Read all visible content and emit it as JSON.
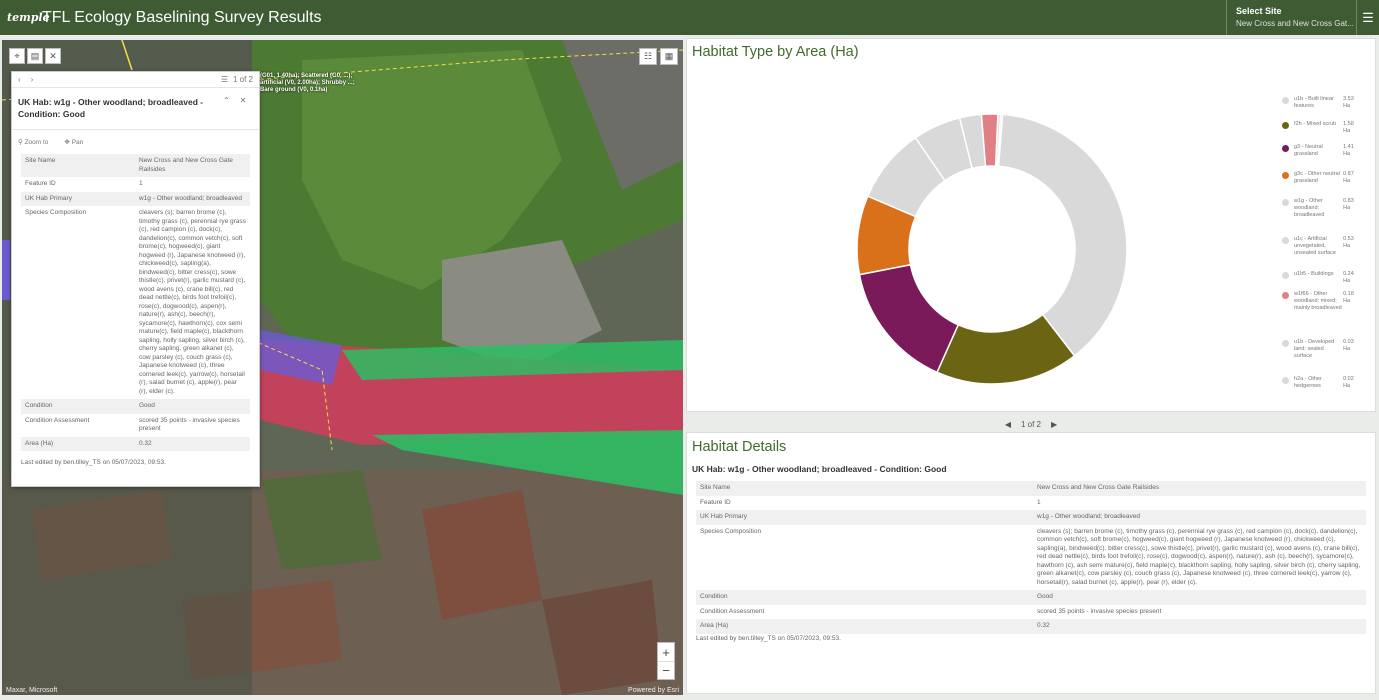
{
  "header": {
    "logo": "temple",
    "title": "TFL Ecology Baselining Survey Results",
    "select_site_label": "Select Site",
    "select_site_value": "New Cross and New Cross Gat...",
    "menu_icon": "hamburger-icon"
  },
  "map": {
    "feature_label": "(G01, 1.40ha); Scattered (G0, ...); artificial (V0, 2.00ha); Shrubby ...; Bare ground (V0, 0.1ha)",
    "attribution_left": "Maxar, Microsoft",
    "attribution_right": "Powered by Esri",
    "zoom_in": "+",
    "zoom_out": "−"
  },
  "popup": {
    "pager": "1 of 2",
    "title": "UK Hab: w1g - Other woodland; broadleaved - Condition: Good",
    "zoom_to": "Zoom to",
    "pan": "Pan",
    "rows": [
      {
        "k": "Site Name",
        "v": "New Cross and New Cross Gate Railsides"
      },
      {
        "k": "Feature ID",
        "v": "1"
      },
      {
        "k": "UK Hab Primary",
        "v": "w1g - Other woodland; broadleaved"
      },
      {
        "k": "Species Composition",
        "v": "cleavers (s); barren brome (c), timothy grass (c), perennial rye grass (c), red campion (c), dock(c), dandelion(c), common vetch(c), soft brome(c), hogweed(c), giant hogweed (r), Japanese knotweed (r), chickweed(c), sapling(a), bindweed(c), bitter cress(c), sowe thistle(c), privet(r), garlic mustard (c), wood avens (c), crane bill(c), red dead nettle(c), birds foot trefoil(c), rose(c), dogwood(c), aspen(r), nature(r), ash(c), beech(r), sycamore(c), hawthorn(c), cox semi mature(c), field maple(c), blackthorn sapling, holly sapling, silver birch (c), cherry sapling, green alkanet (c), cow parsley (c), couch grass (c), Japanese knotweed (c), three cornered leek(c), yarrow(c), horsetail (r), salad burnet (c), apple(r), pear (r), elder (c)."
      },
      {
        "k": "Condition",
        "v": "Good"
      },
      {
        "k": "Condition Assessment",
        "v": "scored 35 points - invasive species present"
      },
      {
        "k": "Area (Ha)",
        "v": "0.32"
      }
    ],
    "last_edited": "Last edited by ben.tilley_TS on 05/07/2023, 09:53."
  },
  "chart": {
    "title": "Habitat Type by Area (Ha)"
  },
  "chart_data": {
    "type": "pie",
    "title": "Habitat Type by Area (Ha)",
    "donut": true,
    "legend_position": "right",
    "series": [
      {
        "name": "u1b - Built linear features",
        "value": 3.53,
        "color": "#d9d9d9"
      },
      {
        "name": "f2h - Mixed scrub",
        "value": 1.58,
        "color": "#6b6412"
      },
      {
        "name": "g3 - Neutral grassland",
        "value": 1.41,
        "color": "#7b1a5a"
      },
      {
        "name": "g3c - Other neutral grassland",
        "value": 0.87,
        "color": "#d9701a"
      },
      {
        "name": "w1g - Other woodland; broadleaved",
        "value": 0.83,
        "color": "#d9d9d9"
      },
      {
        "name": "u1c - Artificial unvegetated, unsealed surface",
        "value": 0.53,
        "color": "#d9d9d9"
      },
      {
        "name": "u1b5 - Buildings",
        "value": 0.24,
        "color": "#d9d9d9"
      },
      {
        "name": "w1f66 - Other woodland; mixed; mainly broadleaved",
        "value": 0.18,
        "color": "#e07f86"
      },
      {
        "name": "u1b - Developed land; sealed surface",
        "value": 0.03,
        "color": "#d9d9d9"
      },
      {
        "name": "h2a - Other hedgerows",
        "value": 0.02,
        "color": "#d9d9d9"
      }
    ],
    "value_labels": [
      "3.53 Ha",
      "1.58 Ha",
      "1.41 Ha",
      "0.87 Ha",
      "0.83 Ha",
      "0.53 Ha",
      "0.24 Ha",
      "0.18 Ha",
      "0.03 Ha",
      "0.02 Ha"
    ]
  },
  "pager": {
    "prev": "◀",
    "text": "1 of 2",
    "next": "▶"
  },
  "details": {
    "title": "Habitat Details",
    "subtitle": "UK Hab: w1g - Other woodland; broadleaved - Condition: Good",
    "rows": [
      {
        "k": "Site Name",
        "v": "New Cross and New Cross Gate Railsides"
      },
      {
        "k": "Feature ID",
        "v": "1"
      },
      {
        "k": "UK Hab Primary",
        "v": "w1g - Other woodland; broadleaved"
      },
      {
        "k": "Species Composition",
        "v": "cleavers (s); barren brome (c), timothy grass (c), perennial rye grass (c), red campion (c), dock(c), dandelion(c), common vetch(c), soft brome(c), hogweed(c), giant hogweed (r), Japanese knotweed (r), chickweed (c), sapling(a), bindweed(c), bitter cress(c), sowe thistle(c), privet(r), garlic mustard (c), wood avens (c), crane bill(c), red dead nettle(c), birds foot trefoil(c), rose(c), dogwood(c), aspen(r), nature(r), ash (c), beech(r), sycamore(c), hawthorn (c), ash semi mature(c), field maple(c), blackthorn sapling, holly sapling, silver birch (c), cherry sapling, green alkanet(c), cow parsley (c), couch grass (c), Japanese knotweed (c), three cornered leek(c), yarrow (c), horsetail(r), salad burnet (c), apple(r), pear (r), elder (c)."
      },
      {
        "k": "Condition",
        "v": "Good"
      },
      {
        "k": "Condition Assessment",
        "v": "scored 35 points - invasive species present"
      },
      {
        "k": "Area (Ha)",
        "v": "0.32"
      }
    ],
    "last_edited": "Last edited by ben.tilley_TS on 05/07/2023, 09:53."
  }
}
